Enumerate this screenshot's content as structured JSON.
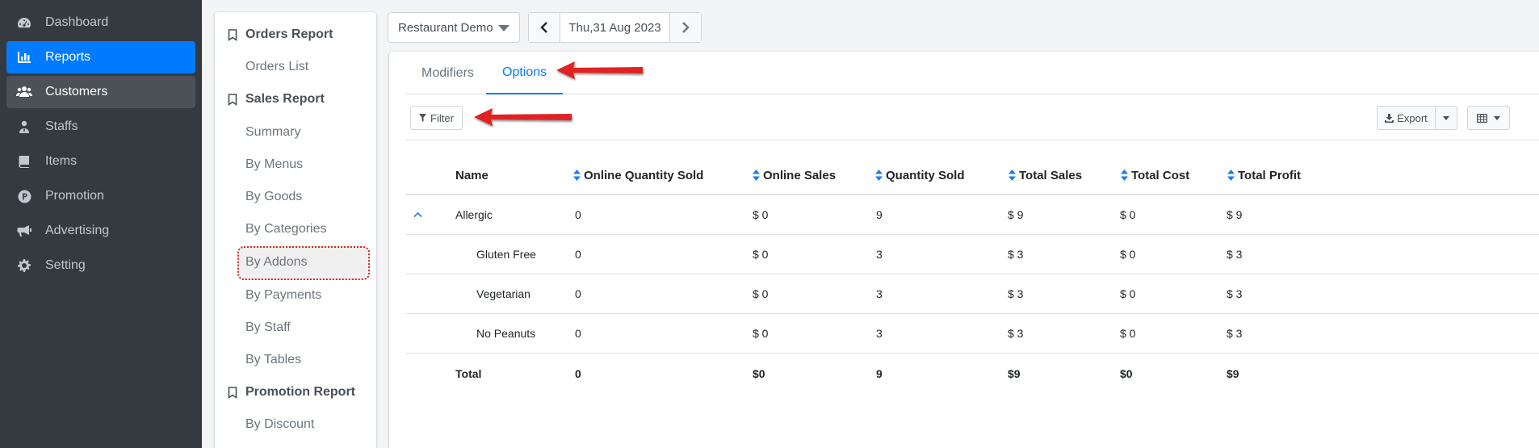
{
  "sidebar": {
    "items": [
      {
        "label": "Dashboard",
        "icon": "tachometer-icon"
      },
      {
        "label": "Reports",
        "icon": "bar-chart-icon"
      },
      {
        "label": "Customers",
        "icon": "users-icon"
      },
      {
        "label": "Staffs",
        "icon": "user-tie-icon"
      },
      {
        "label": "Items",
        "icon": "book-icon"
      },
      {
        "label": "Promotion",
        "icon": "product-hunt-icon"
      },
      {
        "label": "Advertising",
        "icon": "bullhorn-icon"
      },
      {
        "label": "Setting",
        "icon": "gear-icon"
      }
    ],
    "active_color": "#007bff"
  },
  "submenu": {
    "orders_report": "Orders Report",
    "orders_list": "Orders List",
    "sales_report": "Sales Report",
    "summary": "Summary",
    "by_menus": "By Menus",
    "by_goods": "By Goods",
    "by_categories": "By Categories",
    "by_addons": "By Addons",
    "by_payments": "By Payments",
    "by_staff": "By Staff",
    "by_tables": "By Tables",
    "promotion_report": "Promotion Report",
    "by_discount": "By Discount"
  },
  "top": {
    "store": "Restaurant Demo",
    "date": "Thu,31 Aug 2023"
  },
  "tabs": {
    "modifiers": "Modifiers",
    "options": "Options"
  },
  "toolbar": {
    "filter": "Filter",
    "export": "Export"
  },
  "table": {
    "headers": {
      "name": "Name",
      "online_qty": "Online Quantity Sold",
      "online_sales": "Online Sales",
      "qty": "Quantity Sold",
      "total_sales": "Total Sales",
      "total_cost": "Total Cost",
      "total_profit": "Total Profit"
    },
    "rows": [
      {
        "name": "Allergic",
        "online_qty": "0",
        "online_sales": "$ 0",
        "qty": "9",
        "total_sales": "$ 9",
        "total_cost": "$ 0",
        "total_profit": "$ 9"
      },
      {
        "name": "Gluten Free",
        "online_qty": "0",
        "online_sales": "$ 0",
        "qty": "3",
        "total_sales": "$ 3",
        "total_cost": "$ 0",
        "total_profit": "$ 3"
      },
      {
        "name": "Vegetarian",
        "online_qty": "0",
        "online_sales": "$ 0",
        "qty": "3",
        "total_sales": "$ 3",
        "total_cost": "$ 0",
        "total_profit": "$ 3"
      },
      {
        "name": "No Peanuts",
        "online_qty": "0",
        "online_sales": "$ 0",
        "qty": "3",
        "total_sales": "$ 3",
        "total_cost": "$ 0",
        "total_profit": "$ 3"
      }
    ],
    "total": {
      "name": "Total",
      "online_qty": "0",
      "online_sales": "$0",
      "qty": "9",
      "total_sales": "$9",
      "total_cost": "$0",
      "total_profit": "$9"
    }
  },
  "annotation_color": "#e02020"
}
